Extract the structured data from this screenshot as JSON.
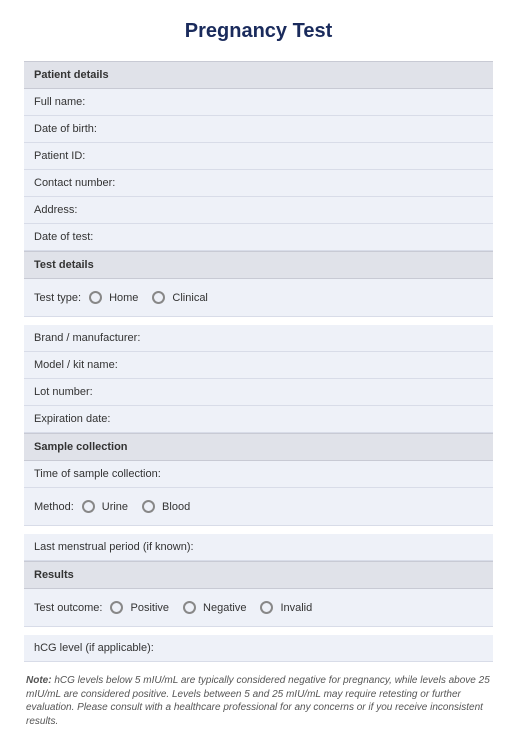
{
  "title": "Pregnancy Test",
  "sections": {
    "patient": {
      "header": "Patient details",
      "fields": {
        "full_name": "Full name:",
        "dob": "Date of birth:",
        "patient_id": "Patient ID:",
        "contact": "Contact number:",
        "address": "Address:",
        "date_of_test": "Date of test:"
      }
    },
    "test": {
      "header": "Test details",
      "fields": {
        "type_label": "Test type:",
        "type_home": "Home",
        "type_clinical": "Clinical",
        "brand": "Brand / manufacturer:",
        "model": "Model / kit name:",
        "lot": "Lot number:",
        "expiration": "Expiration date:"
      }
    },
    "sample": {
      "header": "Sample collection",
      "fields": {
        "time": "Time of sample collection:",
        "method_label": "Method:",
        "method_urine": "Urine",
        "method_blood": "Blood",
        "last_period": "Last menstrual period (if known):"
      }
    },
    "results": {
      "header": "Results",
      "fields": {
        "outcome_label": "Test outcome:",
        "outcome_positive": "Positive",
        "outcome_negative": "Negative",
        "outcome_invalid": "Invalid",
        "hcg": "hCG level (if applicable):"
      }
    }
  },
  "note": {
    "label": "Note:",
    "text": " hCG levels below 5 mIU/mL are typically considered negative for pregnancy, while levels above 25 mIU/mL are considered positive. Levels between 5 and 25 mIU/mL may require retesting or further evaluation. Please consult with a healthcare professional for any concerns or if you receive inconsistent results."
  }
}
